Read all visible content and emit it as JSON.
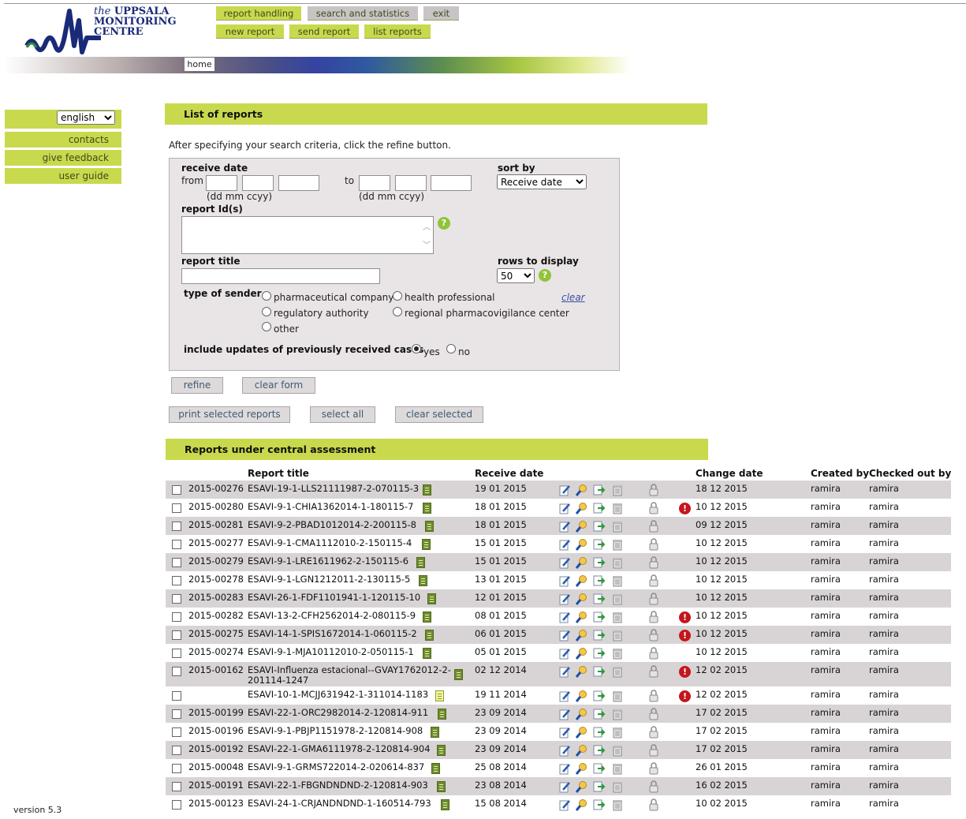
{
  "logo": {
    "the": "the",
    "line1": "UPPSALA",
    "line2": "MONITORING",
    "line3": "CENTRE"
  },
  "nav": {
    "top": [
      "report handling",
      "search and statistics",
      "exit"
    ],
    "sub": [
      "new report",
      "send report",
      "list reports"
    ],
    "home": "home"
  },
  "sidebar": {
    "language": "english",
    "items": [
      "contacts",
      "give feedback",
      "user guide"
    ],
    "version": "version 5.3"
  },
  "list_section": {
    "title": "List of reports",
    "instruction": "After specifying your search criteria, click the refine button."
  },
  "filters": {
    "receive_date_label": "receive date",
    "from_label": "from",
    "to_label": "to",
    "date_format": "(dd mm ccyy)",
    "sort_by_label": "sort by",
    "sort_by_value": "Receive date",
    "report_ids_label": "report Id(s)",
    "report_title_label": "report title",
    "rows_label": "rows to display",
    "rows_value": "50",
    "type_of_sender_label": "type of sender",
    "sender_options": [
      "pharmaceutical company",
      "health professional",
      "regulatory authority",
      "regional pharmacovigilance center",
      "other"
    ],
    "clear_link": "clear",
    "include_updates_label": "include updates of previously received cases",
    "yes": "yes",
    "no": "no"
  },
  "buttons": {
    "refine": "refine",
    "clear_form": "clear form",
    "print_selected": "print selected reports",
    "select_all": "select all",
    "clear_selected": "clear selected"
  },
  "table": {
    "title": "Reports under central assessment",
    "headers": [
      "Report title",
      "Receive date",
      "Change date",
      "Created by",
      "Checked out by"
    ],
    "rows": [
      {
        "id": "2015-00276",
        "title": "ESAVI-19-1-LLS21111987-2-070115-3",
        "receive": "19 01 2015",
        "alert": false,
        "change": "18 12 2015",
        "created": "ramira",
        "checked": "ramira"
      },
      {
        "id": "2015-00280",
        "title": "ESAVI-9-1-CHIA1362014-1-180115-7",
        "receive": "18 01 2015",
        "alert": true,
        "change": "10 12 2015",
        "created": "ramira",
        "checked": "ramira"
      },
      {
        "id": "2015-00281",
        "title": "ESAVI-9-2-PBAD1012014-2-200115-8",
        "receive": "18 01 2015",
        "alert": false,
        "change": "09 12 2015",
        "created": "ramira",
        "checked": "ramira"
      },
      {
        "id": "2015-00277",
        "title": "ESAVI-9-1-CMA1112010-2-150115-4",
        "receive": "15 01 2015",
        "alert": false,
        "change": "10 12 2015",
        "created": "ramira",
        "checked": "ramira"
      },
      {
        "id": "2015-00279",
        "title": "ESAVI-9-1-LRE1611962-2-150115-6",
        "receive": "15 01 2015",
        "alert": false,
        "change": "10 12 2015",
        "created": "ramira",
        "checked": "ramira"
      },
      {
        "id": "2015-00278",
        "title": "ESAVI-9-1-LGN1212011-2-130115-5",
        "receive": "13 01 2015",
        "alert": false,
        "change": "10 12 2015",
        "created": "ramira",
        "checked": "ramira"
      },
      {
        "id": "2015-00283",
        "title": "ESAVI-26-1-FDF1101941-1-120115-10",
        "receive": "12 01 2015",
        "alert": false,
        "change": "10 12 2015",
        "created": "ramira",
        "checked": "ramira"
      },
      {
        "id": "2015-00282",
        "title": "ESAVI-13-2-CFH2562014-2-080115-9",
        "receive": "08 01 2015",
        "alert": true,
        "change": "10 12 2015",
        "created": "ramira",
        "checked": "ramira"
      },
      {
        "id": "2015-00275",
        "title": "ESAVI-14-1-SPIS1672014-1-060115-2",
        "receive": "06 01 2015",
        "alert": true,
        "change": "10 12 2015",
        "created": "ramira",
        "checked": "ramira"
      },
      {
        "id": "2015-00274",
        "title": "ESAVI-9-1-MJA10112010-2-050115-1",
        "receive": "05 01 2015",
        "alert": false,
        "change": "10 12 2015",
        "created": "ramira",
        "checked": "ramira"
      },
      {
        "id": "2015-00162",
        "title": "ESAVI-Influenza estacional--GVAY1762012-2-",
        "title2": "201114-1247",
        "receive": "02 12 2014",
        "alert": true,
        "change": "12 02 2015",
        "created": "ramira",
        "checked": "ramira"
      },
      {
        "id": "",
        "title": "ESAVI-10-1-MCJJ631942-1-311014-1183",
        "receive": "19 11 2014",
        "alert": true,
        "light": true,
        "change": "12 02 2015",
        "created": "ramira",
        "checked": "ramira"
      },
      {
        "id": "2015-00199",
        "title": "ESAVI-22-1-ORC2982014-2-120814-911",
        "receive": "23 09 2014",
        "alert": false,
        "change": "17 02 2015",
        "created": "ramira",
        "checked": "ramira"
      },
      {
        "id": "2015-00196",
        "title": "ESAVI-9-1-PBJP1151978-2-120814-908",
        "receive": "23 09 2014",
        "alert": false,
        "change": "17 02 2015",
        "created": "ramira",
        "checked": "ramira"
      },
      {
        "id": "2015-00192",
        "title": "ESAVI-22-1-GMA6111978-2-120814-904",
        "receive": "23 09 2014",
        "alert": false,
        "change": "17 02 2015",
        "created": "ramira",
        "checked": "ramira"
      },
      {
        "id": "2015-00048",
        "title": "ESAVI-9-1-GRMS722014-2-020614-837",
        "receive": "25 08 2014",
        "alert": false,
        "change": "26 01 2015",
        "created": "ramira",
        "checked": "ramira"
      },
      {
        "id": "2015-00191",
        "title": "ESAVI-22-1-FBGNDNDND-2-120814-903",
        "receive": "23 08 2014",
        "alert": false,
        "change": "16 02 2015",
        "created": "ramira",
        "checked": "ramira"
      },
      {
        "id": "2015-00123",
        "title": "ESAVI-24-1-CRJANDNDND-1-160514-793",
        "receive": "15 08 2014",
        "alert": false,
        "change": "10 02 2015",
        "created": "ramira",
        "checked": "ramira"
      }
    ]
  },
  "colors": {
    "accent": "#c9d94e",
    "row_alt": "#d8d4d6",
    "alert": "#c4161c"
  }
}
